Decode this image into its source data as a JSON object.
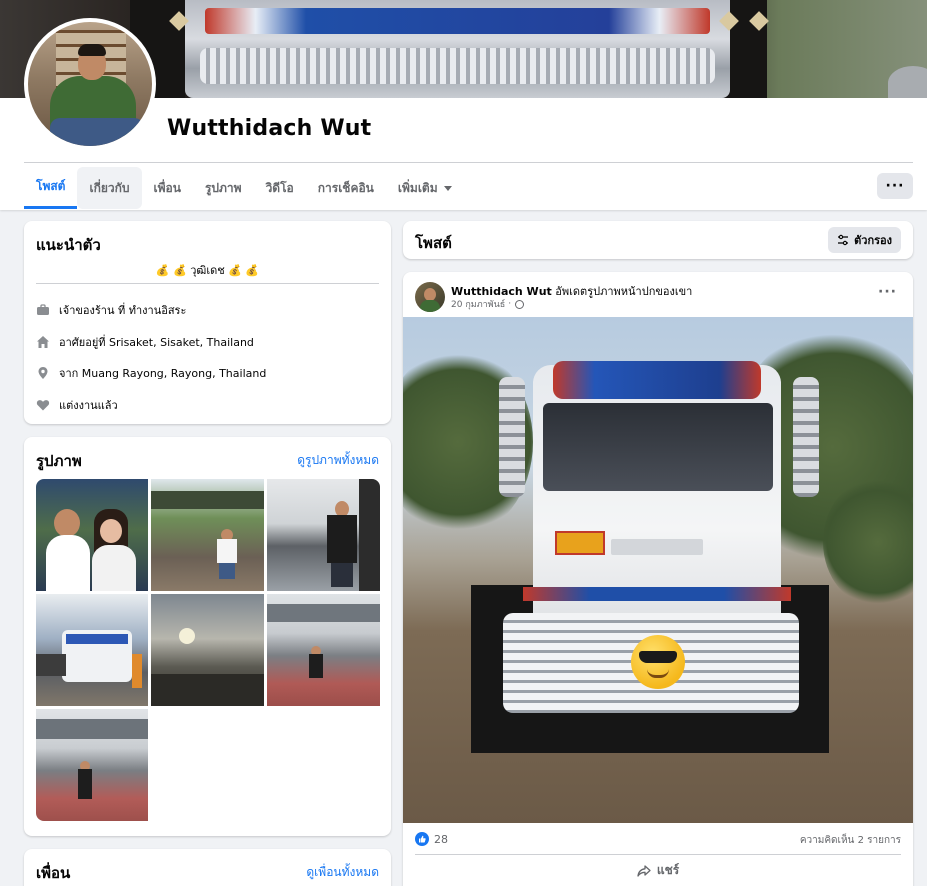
{
  "profile": {
    "name": "Wutthidach Wut"
  },
  "tabs": [
    {
      "label": "โพสต์"
    },
    {
      "label": "เกี่ยวกับ"
    },
    {
      "label": "เพื่อน"
    },
    {
      "label": "รูปภาพ"
    },
    {
      "label": "วิดีโอ"
    },
    {
      "label": "การเช็คอิน"
    },
    {
      "label": "เพิ่มเติม"
    }
  ],
  "more_button": {
    "label": "···"
  },
  "intro": {
    "title": "แนะนำตัว",
    "bio": "💰 💰 วุฒิเดช 💰 💰",
    "items": [
      {
        "icon": "briefcase-icon",
        "text": "เจ้าของร้าน ที่ ทำงานอิสระ"
      },
      {
        "icon": "home-icon",
        "text": "อาศัยอยู่ที่ Srisaket, Sisaket, Thailand"
      },
      {
        "icon": "location-pin-icon",
        "text": "จาก Muang Rayong, Rayong, Thailand"
      },
      {
        "icon": "heart-icon",
        "text": "แต่งงานแล้ว"
      }
    ]
  },
  "photos": {
    "title": "รูปภาพ",
    "link": "ดูรูปภาพทั้งหมด"
  },
  "friends": {
    "title": "เพื่อน",
    "link": "ดูเพื่อนทั้งหมด"
  },
  "posts_header": {
    "title": "โพสต์",
    "filter_label": "ตัวกรอง"
  },
  "post": {
    "author": "Wutthidach Wut",
    "action": "อัพเดตรูปภาพหน้าปกของเขา",
    "date": "20 กุมภาพันธ์",
    "likes": "28",
    "comments": "ความคิดเห็น 2 รายการ",
    "share_label": "แชร์",
    "menu": "···"
  },
  "colors": {
    "accent": "#1877f2",
    "background": "#f0f2f5",
    "card": "#ffffff",
    "secondary_text": "#65676b"
  }
}
